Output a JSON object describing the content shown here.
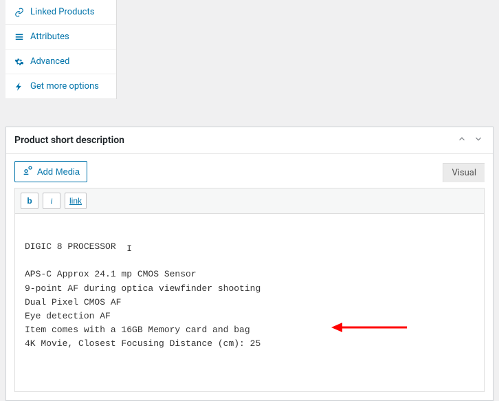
{
  "sidebar": {
    "items": [
      {
        "label": "Linked Products",
        "icon": "link-icon"
      },
      {
        "label": "Attributes",
        "icon": "list-icon"
      },
      {
        "label": "Advanced",
        "icon": "gear-icon"
      },
      {
        "label": "Get more options",
        "icon": "bolt-icon"
      }
    ]
  },
  "metabox": {
    "title": "Product short description",
    "add_media_label": "Add Media",
    "tabs": {
      "visual": "Visual"
    },
    "format": {
      "bold": "b",
      "italic": "i",
      "link": "link"
    },
    "content": {
      "line1": "DIGIC 8 PROCESSOR",
      "caret_glyph": "I",
      "line2": "APS-C Approx 24.1 mp CMOS Sensor",
      "line3": "9-point AF during optica viewfinder shooting",
      "line4": "Dual Pixel CMOS AF",
      "line5": "Eye detection AF",
      "line6": "Item comes with a 16GB Memory card and bag",
      "line7": "4K Movie, Closest Focusing Distance (cm): 25"
    }
  },
  "annotation": {
    "arrow_color": "#ff0000"
  }
}
